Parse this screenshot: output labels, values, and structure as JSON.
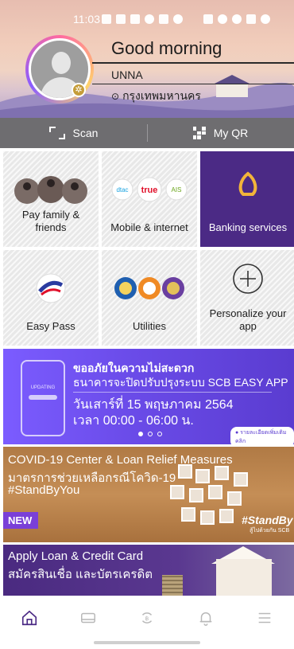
{
  "status_bar": {
    "time": "11:03"
  },
  "header": {
    "greeting": "Good morning",
    "user_name": "UNNA",
    "location": "กรุงเทพมหานคร"
  },
  "quick_actions": {
    "scan_label": "Scan",
    "qr_label": "My QR"
  },
  "tiles": [
    {
      "label_line1": "Pay family &",
      "label_line2": "friends"
    },
    {
      "label_line1": "Mobile & internet",
      "label_line2": "",
      "logos": [
        "dtac",
        "true",
        "AIS"
      ]
    },
    {
      "label_line1": "Banking services",
      "label_line2": ""
    },
    {
      "label_line1": "Easy Pass",
      "label_line2": ""
    },
    {
      "label_line1": "Utilities",
      "label_line2": ""
    },
    {
      "label_line1": "Personalize your",
      "label_line2": "app"
    }
  ],
  "banner_maintenance": {
    "title": "ขออภัยในความไม่สะดวก",
    "subtitle": "ธนาคารจะปิดปรับปรุงระบบ SCB EASY APP",
    "date": "วันเสาร์ที่ 15 พฤษภาคม 2564",
    "time": "เวลา 00:00 - 06:00 น.",
    "phone_text": "UPDATING",
    "pill": "● รายละเอียดเพิ่มเติมคลิก"
  },
  "banner_covid": {
    "line1": "COVID-19 Center & Loan Relief Measures",
    "line2": "มาตรการช่วยเหลือกรณีโควิด-19",
    "line3": "#StandByYou",
    "badge": "NEW",
    "tag": "#StandByYou",
    "tag_sub": "สู้ไปด้วยกัน SCB"
  },
  "banner_loan": {
    "line1": "Apply Loan & Credit Card",
    "line2": "สมัครสินเชื่อ และบัตรเครดิต"
  },
  "bottom_nav": [
    "home-icon",
    "card-icon",
    "transfer-icon",
    "bell-icon",
    "menu-icon"
  ],
  "colors": {
    "accent_purple": "#4b2a85",
    "nav_active": "#4b2a85",
    "nav_inactive": "#b8b8b8"
  }
}
